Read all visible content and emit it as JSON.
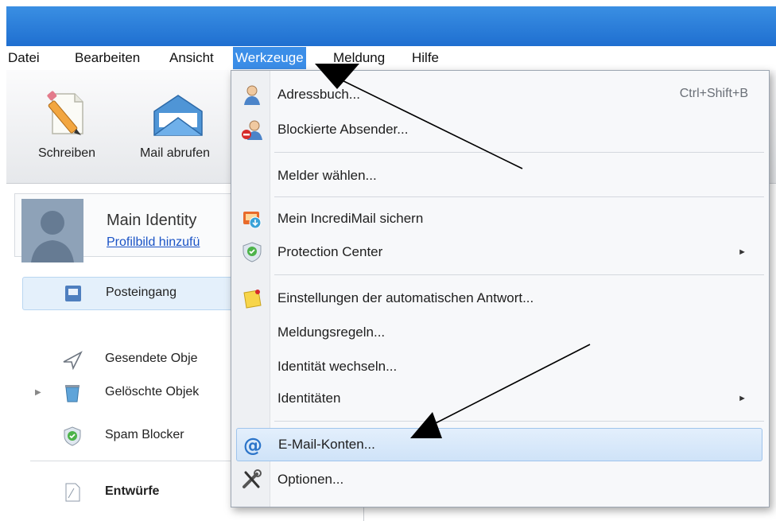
{
  "menubar": {
    "items": [
      {
        "label": "Datei"
      },
      {
        "label": "Bearbeiten"
      },
      {
        "label": "Ansicht"
      },
      {
        "label": "Werkzeuge"
      },
      {
        "label": "Meldung"
      },
      {
        "label": "Hilfe"
      }
    ]
  },
  "toolbar": {
    "write_label": "Schreiben",
    "fetch_label": "Mail abrufen"
  },
  "identity": {
    "name": "Main Identity",
    "profile_link": "Profilbild hinzufü"
  },
  "folders": [
    {
      "name": "Posteingang"
    },
    {
      "name": "Gesendete Obje"
    },
    {
      "name": "Gelöschte Objek"
    },
    {
      "name": "Spam Blocker"
    },
    {
      "name": "Entwürfe"
    }
  ],
  "dropdown": {
    "items": [
      {
        "label": "Adressbuch...",
        "shortcut": "Ctrl+Shift+B",
        "icon": "address-book-icon"
      },
      {
        "label": "Blockierte Absender...",
        "icon": "blocked-sender-icon"
      },
      {
        "label": "Melder wählen..."
      },
      {
        "label": "Mein IncrediMail sichern",
        "icon": "backup-icon"
      },
      {
        "label": "Protection Center",
        "icon": "shield-icon",
        "submenu": true
      },
      {
        "label": "Einstellungen der automatischen Antwort...",
        "icon": "note-icon"
      },
      {
        "label": "Meldungsregeln..."
      },
      {
        "label": "Identität wechseln..."
      },
      {
        "label": "Identitäten",
        "submenu": true
      },
      {
        "label": "E-Mail-Konten...",
        "icon": "at-sign-icon",
        "highlighted": true
      },
      {
        "label": "Optionen...",
        "icon": "tools-icon"
      }
    ],
    "submenu_glyph": "►"
  },
  "colors": {
    "titlebar": "#2b7fde",
    "highlight": "#3b8ee8",
    "link": "#1a53c6"
  }
}
